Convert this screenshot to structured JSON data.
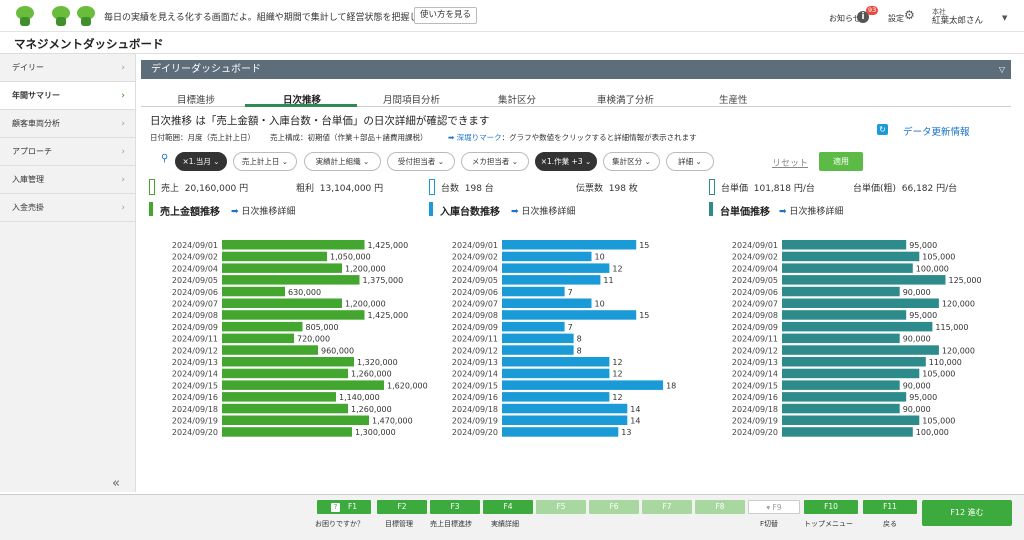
{
  "topbar": {
    "message": "毎日の実績を見える化する画面だよ。組織や期間で集計して経営状態を把握しようね。",
    "howto_button": "使い方を見る",
    "notice_label": "お知らせ",
    "notice_count": "93",
    "settings_label": "設定",
    "user_org": "本社",
    "user_name": "紅葉太郎さん"
  },
  "app": {
    "title": "マネジメントダッシュボード"
  },
  "sidebar": {
    "items": [
      {
        "label": "デイリー"
      },
      {
        "label": "年間サマリー"
      },
      {
        "label": "顧客車両分析"
      },
      {
        "label": "アプローチ"
      },
      {
        "label": "入庫管理"
      },
      {
        "label": "入金売掛"
      }
    ],
    "collapse_icon": "«"
  },
  "panel": {
    "title": "デイリーダッシュボード"
  },
  "tabs": [
    "目標進捗",
    "日次推移",
    "月間項目分析",
    "集計区分",
    "車検満了分析",
    "生産性"
  ],
  "content": {
    "heading": "日次推移 は「売上金額・入庫台数・台単価」の日次詳細が確認できます",
    "date_range": "日付範囲：月度（売上計上日）",
    "sales_composition": "売上構成：初期値（作業＋部品＋諸費用課税）",
    "drilldown_mark": "➡ 深堀りマーク",
    "drilldown_text": "：グラフや数値をクリックすると詳細情報が表示されます",
    "refresh_label": "データ更新情報"
  },
  "filters": {
    "chips": [
      "×1.当月",
      "売上計上日",
      "実績計上組織",
      "受付担当者",
      "メカ担当者",
      "×1.作業 +3",
      "集計区分",
      "詳細"
    ],
    "reset": "リセット",
    "apply": "適用"
  },
  "stats": {
    "sales_label": "売上",
    "sales_value": "20,160,000 円",
    "gross_label": "粗利",
    "gross_value": "13,104,000 円",
    "units_label": "台数",
    "units_value": "198 台",
    "slips_label": "伝票数",
    "slips_value": "198 枚",
    "unit_price_label": "台単価",
    "unit_price_value": "101,818 円/台",
    "unit_price_gross_label": "台単価(粗)",
    "unit_price_gross_value": "66,182 円/台"
  },
  "sections": [
    {
      "title": "売上金額推移",
      "link": "日次推移詳細"
    },
    {
      "title": "入庫台数推移",
      "link": "日次推移詳細"
    },
    {
      "title": "台単価推移",
      "link": "日次推移詳細"
    }
  ],
  "colors": {
    "sales": "#43a62f",
    "units": "#1a9ad6",
    "price": "#2e8b8b",
    "accent": "#3caa3c"
  },
  "chart_data": [
    {
      "type": "bar",
      "orientation": "horizontal",
      "title": "売上金額推移",
      "categories": [
        "2024/09/01",
        "2024/09/02",
        "2024/09/04",
        "2024/09/05",
        "2024/09/06",
        "2024/09/07",
        "2024/09/08",
        "2024/09/09",
        "2024/09/11",
        "2024/09/12",
        "2024/09/13",
        "2024/09/14",
        "2024/09/15",
        "2024/09/16",
        "2024/09/18",
        "2024/09/19",
        "2024/09/20"
      ],
      "values": [
        1425000,
        1050000,
        1200000,
        1375000,
        630000,
        1200000,
        1425000,
        805000,
        720000,
        960000,
        1320000,
        1260000,
        1620000,
        1140000,
        1260000,
        1470000,
        1300000
      ],
      "labels": [
        "1,425,000",
        "1,050,000",
        "1,200,000",
        "1,375,000",
        "630,000",
        "1,200,000",
        "1,425,000",
        "805,000",
        "720,000",
        "960,000",
        "1,320,000",
        "1,260,000",
        "1,620,000",
        "1,140,000",
        "1,260,000",
        "1,470,000",
        "1,300,000"
      ],
      "xmax": 1700000
    },
    {
      "type": "bar",
      "orientation": "horizontal",
      "title": "入庫台数推移",
      "categories": [
        "2024/09/01",
        "2024/09/02",
        "2024/09/04",
        "2024/09/05",
        "2024/09/06",
        "2024/09/07",
        "2024/09/08",
        "2024/09/09",
        "2024/09/11",
        "2024/09/12",
        "2024/09/13",
        "2024/09/14",
        "2024/09/15",
        "2024/09/16",
        "2024/09/18",
        "2024/09/19",
        "2024/09/20"
      ],
      "values": [
        15,
        10,
        12,
        11,
        7,
        10,
        15,
        7,
        8,
        8,
        12,
        12,
        18,
        12,
        14,
        14,
        13
      ],
      "labels": [
        "15",
        "10",
        "12",
        "11",
        "7",
        "10",
        "15",
        "7",
        "8",
        "8",
        "12",
        "12",
        "18",
        "12",
        "14",
        "14",
        "13"
      ],
      "xmax": 19
    },
    {
      "type": "bar",
      "orientation": "horizontal",
      "title": "台単価推移",
      "categories": [
        "2024/09/01",
        "2024/09/02",
        "2024/09/04",
        "2024/09/05",
        "2024/09/06",
        "2024/09/07",
        "2024/09/08",
        "2024/09/09",
        "2024/09/11",
        "2024/09/12",
        "2024/09/13",
        "2024/09/14",
        "2024/09/15",
        "2024/09/16",
        "2024/09/18",
        "2024/09/19",
        "2024/09/20"
      ],
      "values": [
        95000,
        105000,
        100000,
        125000,
        90000,
        120000,
        95000,
        115000,
        90000,
        120000,
        110000,
        105000,
        90000,
        95000,
        90000,
        105000,
        100000
      ],
      "labels": [
        "95,000",
        "105,000",
        "100,000",
        "125,000",
        "90,000",
        "120,000",
        "95,000",
        "115,000",
        "90,000",
        "120,000",
        "110,000",
        "105,000",
        "90,000",
        "95,000",
        "90,000",
        "105,000",
        "100,000"
      ],
      "xmax": 130000
    }
  ],
  "footer": {
    "keys": [
      "F1",
      "F2",
      "F3",
      "F4",
      "F5",
      "F6",
      "F7",
      "F8",
      "F9",
      "F10",
      "F11"
    ],
    "labels": {
      "f1": "お困りですか？",
      "f2": "目標管理",
      "f3": "売上目標進捗",
      "f4": "実績詳細",
      "f9": "F切替",
      "f10": "トップメニュー",
      "f11": "戻る"
    },
    "f12": "F12  進む"
  }
}
